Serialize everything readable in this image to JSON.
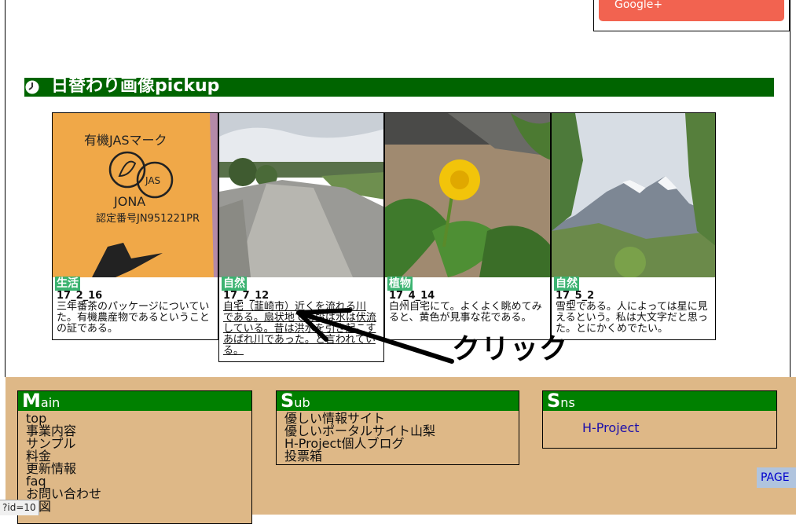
{
  "social": {
    "google_label": "Google+"
  },
  "section": {
    "title": "日替わり画像pickup"
  },
  "cards": [
    {
      "category": "生活",
      "date": "17_2_16",
      "description": "三年番茶のパッケージについていた。有機農産物であるということの証である。"
    },
    {
      "category": "自然",
      "date": "17_7_12",
      "description": "自宅（韮崎市）近くを流れる川である。扇状地で普段は水は伏流している。昔は洪水を引き起こすあばれ川であった。と言われている。"
    },
    {
      "category": "植物",
      "date": "17_4_14",
      "description": "白州自宅にて。よくよく眺めてみると、黄色が見事な花である。"
    },
    {
      "category": "自然",
      "date": "17_5_2",
      "description": "雪型である。人によっては星に見えるという。私は大文字だと思った。とにかくめでたい。"
    }
  ],
  "annotation": {
    "click_text": "クリック"
  },
  "photo_text": {
    "jas_title": "有機JASマーク",
    "jas_logo": "JAS",
    "jas_org": "JONA",
    "jas_cert": "認定番号JN951221PR"
  },
  "footer": {
    "main": {
      "initial": "M",
      "rest": "ain",
      "items": [
        "top",
        "事業内容",
        "サンプル",
        "料金",
        "更新情報",
        "faq",
        "お問い合わせ",
        "地図"
      ]
    },
    "sub": {
      "initial": "S",
      "rest": "ub",
      "items": [
        "優しい情報サイト",
        "優しいポータルサイト山梨",
        "H-Project個人ブログ",
        "投票箱"
      ]
    },
    "sns": {
      "initial": "S",
      "rest": "ns",
      "link": "H-Project"
    }
  },
  "page_top": "PAGE",
  "status_url": "?id=10",
  "colors": {
    "section_bar": "#006400",
    "category_badge": "#3cb371",
    "footer_bg": "#deb887",
    "footer_header": "#008000",
    "google": "#f26350"
  }
}
